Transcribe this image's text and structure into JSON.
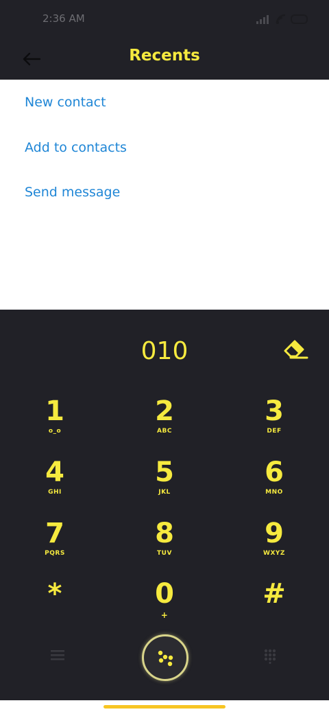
{
  "status_bar": {
    "time": "2:36 AM"
  },
  "app_bar": {
    "title": "Recents",
    "back_icon": "arrow-left-icon"
  },
  "menu": {
    "items": [
      {
        "label": "New contact"
      },
      {
        "label": "Add to contacts"
      },
      {
        "label": "Send message"
      }
    ]
  },
  "dialer": {
    "number": "010",
    "erase_icon": "eraser-icon",
    "keys": [
      {
        "digit": "1",
        "letters": "o_o"
      },
      {
        "digit": "2",
        "letters": "ABC"
      },
      {
        "digit": "3",
        "letters": "DEF"
      },
      {
        "digit": "4",
        "letters": "GHI"
      },
      {
        "digit": "5",
        "letters": "JKL"
      },
      {
        "digit": "6",
        "letters": "MNO"
      },
      {
        "digit": "7",
        "letters": "PQRS"
      },
      {
        "digit": "8",
        "letters": "TUV"
      },
      {
        "digit": "9",
        "letters": "WXYZ"
      },
      {
        "digit": "*",
        "letters": ""
      },
      {
        "digit": "0",
        "letters": "+"
      },
      {
        "digit": "#",
        "letters": ""
      }
    ],
    "bottom_bar": {
      "left_icon": "menu-icon",
      "center_icon": "call-dots-icon",
      "right_icon": "keypad-icon"
    }
  },
  "colors": {
    "accent": "#f6ea3f",
    "link": "#1f86d6",
    "dark_bg": "#212127",
    "nav_pill": "#f7c523"
  }
}
